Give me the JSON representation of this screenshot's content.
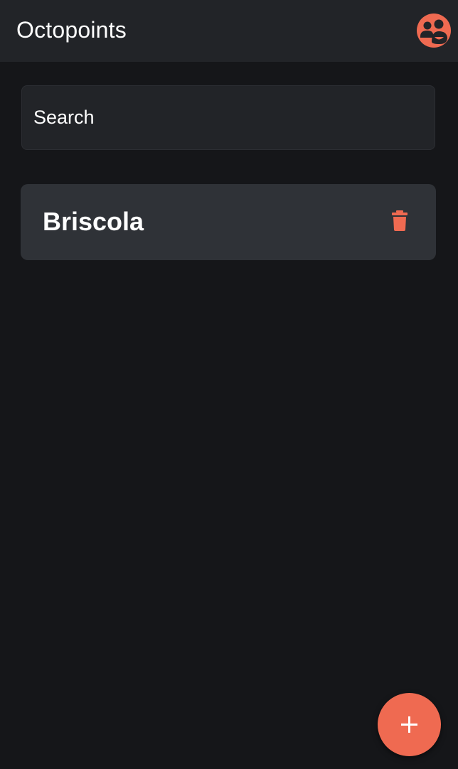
{
  "app_bar": {
    "title": "Octopoints",
    "avatar_icon": "groups-icon"
  },
  "search": {
    "placeholder": "Search",
    "value": ""
  },
  "games": [
    {
      "name": "Briscola",
      "delete_icon": "trash-icon"
    }
  ],
  "fab": {
    "icon": "plus-icon"
  },
  "colors": {
    "accent": "#ef6a51",
    "background": "#151619",
    "app_bar": "#222428",
    "card": "#2f3237",
    "text": "#ffffff"
  }
}
